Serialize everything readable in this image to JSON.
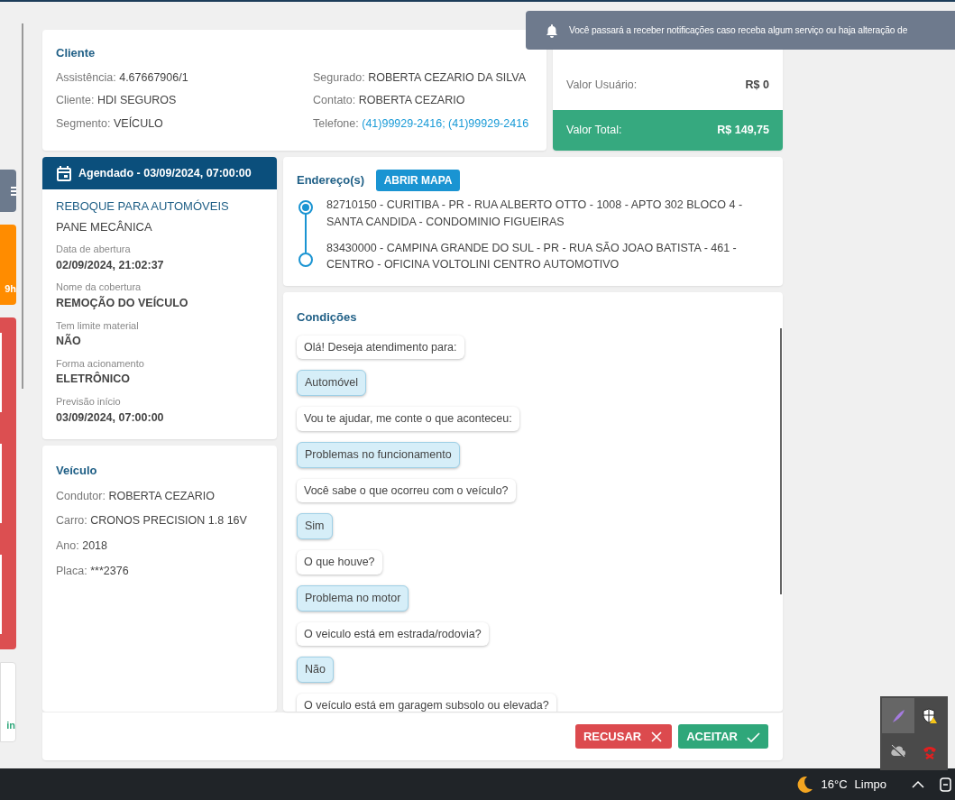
{
  "side_panel": [
    {
      "kind": "menu",
      "color": "#6c7a8d"
    },
    {
      "kind": "timer",
      "color": "#ff8c00",
      "text": "9h"
    },
    {
      "kind": "alert",
      "color": "#dc4f51"
    },
    {
      "kind": "info",
      "color": "#ffffff",
      "text": "in"
    }
  ],
  "notification": {
    "text": "Você passará a receber notificações caso receba algum serviço ou haja alteração de"
  },
  "cliente": {
    "title": "Cliente",
    "fields": [
      {
        "label": "Assistência:",
        "value": "4.67667906/1",
        "kind": "text"
      },
      {
        "label": "Segurado:",
        "value": "ROBERTA CEZARIO DA SILVA",
        "kind": "text"
      },
      {
        "label": "Cliente:",
        "value": "HDI SEGUROS",
        "kind": "text"
      },
      {
        "label": "Contato:",
        "value": "ROBERTA CEZARIO",
        "kind": "text"
      },
      {
        "label": "Segmento:",
        "value": "VEÍCULO",
        "kind": "text"
      },
      {
        "label": "Telefone:",
        "value": "(41)99929-2416; (41)99929-2416",
        "kind": "link"
      }
    ]
  },
  "valores": {
    "rows": [
      {
        "label": "Valor Usuário:",
        "value": "R$ 0"
      }
    ],
    "total": {
      "label": "Valor Total:",
      "value": "R$ 149,75"
    }
  },
  "agendamento": {
    "header": "Agendado - 03/09/2024, 07:00:00",
    "service": "REBOQUE PARA AUTOMÓVEIS",
    "problem": "PANE MECÂNICA",
    "details": [
      {
        "label": "Data de abertura",
        "value": "02/09/2024, 21:02:37"
      },
      {
        "label": "Nome da cobertura",
        "value": "REMOÇÃO DO VEÍCULO"
      },
      {
        "label": "Tem limite material",
        "value": "NÃO"
      },
      {
        "label": "Forma acionamento",
        "value": "ELETRÔNICO"
      },
      {
        "label": "Previsão início",
        "value": "03/09/2024, 07:00:00"
      }
    ]
  },
  "veiculo": {
    "title": "Veículo",
    "fields": [
      {
        "label": "Condutor:",
        "value": "ROBERTA CEZARIO"
      },
      {
        "label": "Carro:",
        "value": "CRONOS PRECISION 1.8 16V"
      },
      {
        "label": "Ano:",
        "value": "2018"
      },
      {
        "label": "Placa:",
        "value": "***2376"
      }
    ]
  },
  "enderecos": {
    "title": "Endereço(s)",
    "map_button": "ABRIR MAPA",
    "stops": [
      {
        "kind": "origin",
        "text": "82710150 - CURITIBA - PR - RUA ALBERTO OTTO - 1008 - APTO 302 BLOCO 4 - SANTA CANDIDA - CONDOMINIO FIGUEIRAS"
      },
      {
        "kind": "destination",
        "text": "83430000 - CAMPINA GRANDE DO SUL - PR - RUA SÃO JOAO BATISTA - 461 - CENTRO - OFICINA VOLTOLINI CENTRO AUTOMOTIVO"
      }
    ]
  },
  "condicoes": {
    "title": "Condições",
    "messages": [
      {
        "kind": "question",
        "text": "Olá! Deseja atendimento para:"
      },
      {
        "kind": "answer",
        "text": "Automóvel"
      },
      {
        "kind": "question",
        "text": "Vou te ajudar, me conte o que aconteceu:"
      },
      {
        "kind": "answer",
        "text": "Problemas no funcionamento"
      },
      {
        "kind": "question",
        "text": "Você sabe o que ocorreu com o veículo?"
      },
      {
        "kind": "answer",
        "text": "Sim"
      },
      {
        "kind": "question",
        "text": "O que houve?"
      },
      {
        "kind": "answer",
        "text": "Problema no motor"
      },
      {
        "kind": "question",
        "text": "O veiculo está em estrada/rodovia?"
      },
      {
        "kind": "answer",
        "text": "Não"
      },
      {
        "kind": "question",
        "text": "O veículo está em garagem subsolo ou elevada?"
      }
    ]
  },
  "actions": [
    {
      "kind": "reject",
      "label": "RECUSAR"
    },
    {
      "kind": "accept",
      "label": "ACEITAR"
    }
  ],
  "tray_icons": [
    {
      "kind": "feather",
      "selected": true
    },
    {
      "kind": "shield",
      "selected": false
    },
    {
      "kind": "cloud",
      "selected": false
    },
    {
      "kind": "phone",
      "selected": false
    }
  ],
  "taskbar": {
    "temperature": "16°C",
    "weather": "Limpo"
  }
}
